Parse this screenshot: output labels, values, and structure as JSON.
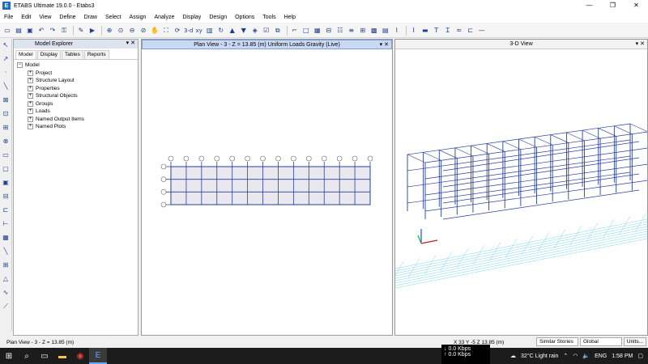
{
  "window": {
    "title": "ETABS Ultimate 19.0.0 - Etabs3",
    "app_icon_letter": "E",
    "min_glyph": "—",
    "max_glyph": "❐",
    "close_glyph": "✕"
  },
  "menu": [
    "File",
    "Edit",
    "View",
    "Define",
    "Draw",
    "Select",
    "Assign",
    "Analyze",
    "Display",
    "Design",
    "Options",
    "Tools",
    "Help"
  ],
  "toolbar": {
    "view_3d_label": "3-d",
    "view_plan_label": "xy",
    "icons": [
      "new-icon",
      "open-icon",
      "save-icon",
      "undo-icon",
      "redo-icon",
      "lock-icon",
      "pencil-icon",
      "run-icon",
      "zoom-in-icon",
      "zoom-window-icon",
      "zoom-out-icon",
      "zoom-prev-icon",
      "pan-icon",
      "zoom-all-icon",
      "refresh-icon",
      "3d-view-icon",
      "plan-view-icon",
      "elevation-icon",
      "rotate-icon",
      "up-arrow-icon",
      "down-arrow-icon",
      "perspective-icon",
      "select-icon",
      "object-shrink-icon"
    ]
  },
  "explorer": {
    "title": "Model Explorer",
    "tabs": [
      "Model",
      "Display",
      "Tables",
      "Reports"
    ],
    "root": "Model",
    "items": [
      "Project",
      "Structure Layout",
      "Properties",
      "Structural Objects",
      "Groups",
      "Loads",
      "Named Output Items",
      "Named Plots"
    ]
  },
  "plan_view": {
    "title": "Plan View - 3 - Z = 13.85 (m)  Uniform Loads Gravity  (Live)",
    "grid_bubbles": [
      "1",
      "2",
      "3",
      "4",
      "5",
      "6",
      "7",
      "8",
      "9",
      "10",
      "11",
      "12",
      "13",
      "14"
    ]
  },
  "view_3d": {
    "title": "3-D View"
  },
  "status": {
    "left": "Plan View - 3 - Z = 13.85 (m)",
    "coords": "X 33  Y -5  Z 13.85 (m)",
    "stories": "Similar Stories",
    "coord_system": "Global",
    "units": "Units..."
  },
  "network": {
    "down": "0.0 Kbps",
    "up": "0.0 Kbps"
  },
  "tray": {
    "weather": "32°C  Light rain",
    "lang": "ENG",
    "time": "1:58 PM"
  },
  "colors": {
    "frame_blue": "#2a3f9e",
    "ground_grid": "#7fd4f0",
    "active_pane_header": "#c9d9f4",
    "taskbar": "#1c1c1c"
  }
}
